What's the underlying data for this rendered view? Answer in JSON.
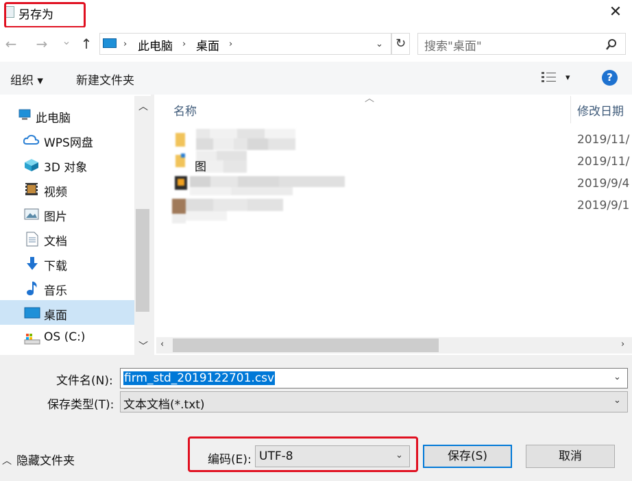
{
  "window": {
    "title": "另存为",
    "close_glyph": "✕"
  },
  "nav": {
    "back": "←",
    "forward": "→",
    "recent": "⌄",
    "up": "↑",
    "breadcrumb": [
      "此电脑",
      "桌面"
    ],
    "refresh": "↻",
    "search_placeholder": "搜索\"桌面\""
  },
  "toolbar": {
    "organize": "组织 ▾",
    "new_folder": "新建文件夹",
    "view_dropdown": "▾",
    "help": "?"
  },
  "sidebar": {
    "items": [
      {
        "label": "此电脑",
        "icon": "computer-icon"
      },
      {
        "label": "WPS网盘",
        "icon": "cloud-icon"
      },
      {
        "label": "3D 对象",
        "icon": "cube-icon"
      },
      {
        "label": "视频",
        "icon": "video-icon"
      },
      {
        "label": "图片",
        "icon": "picture-icon"
      },
      {
        "label": "文档",
        "icon": "document-icon"
      },
      {
        "label": "下载",
        "icon": "download-icon"
      },
      {
        "label": "音乐",
        "icon": "music-icon"
      },
      {
        "label": "桌面",
        "icon": "desktop-icon",
        "selected": true
      },
      {
        "label": "OS (C:)",
        "icon": "drive-icon"
      }
    ]
  },
  "file_list": {
    "columns": {
      "name": "名称",
      "modified": "修改日期"
    },
    "rows": [
      {
        "name": "",
        "modified": "2019/11/"
      },
      {
        "name": "图",
        "modified": "2019/11/"
      },
      {
        "name": "",
        "modified": "2019/9/4"
      },
      {
        "name": "",
        "modified": "2019/9/1"
      }
    ]
  },
  "form": {
    "filename_label": "文件名(N):",
    "filename_value": "firm_std_2019122701.csv",
    "filetype_label": "保存类型(T):",
    "filetype_value": "文本文档(*.txt)",
    "hide_folders": "隐藏文件夹",
    "encoding_label": "编码(E):",
    "encoding_value": "UTF-8",
    "save_button": "保存(S)",
    "cancel_button": "取消"
  },
  "colors": {
    "highlight": "#e01020",
    "accent": "#0078d7",
    "selected_nav": "#cce4f7"
  }
}
